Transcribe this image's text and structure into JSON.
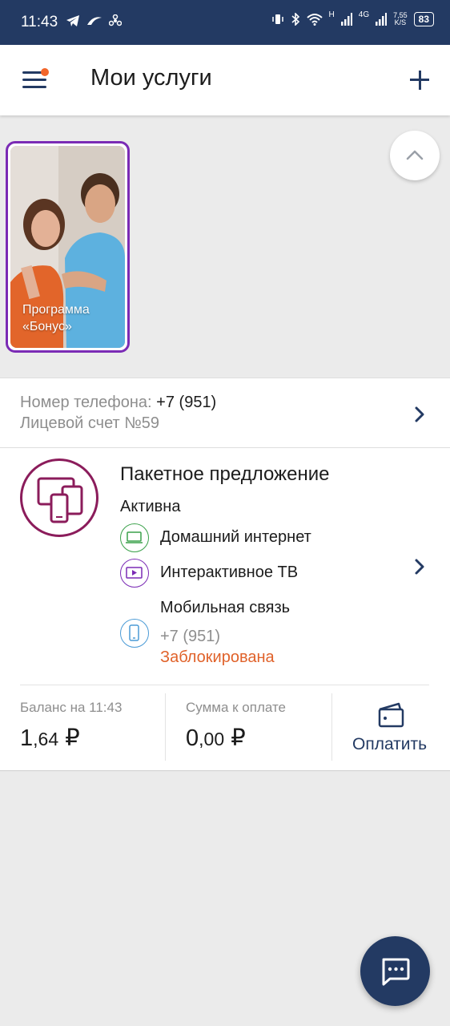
{
  "status_bar": {
    "time": "11:43",
    "network": "4G",
    "network_extra": "H",
    "net_speed_value": "7,55",
    "net_speed_unit": "K/S",
    "battery": "83"
  },
  "app_bar": {
    "title": "Мои услуги"
  },
  "promo": {
    "label_line1": "Программа",
    "label_line2": "«Бонус»"
  },
  "account": {
    "phone_label": "Номер телефона: ",
    "phone_value": "+7 (951)",
    "contract_label": "Лицевой счет №59"
  },
  "package": {
    "title": "Пакетное предложение",
    "status": "Активна",
    "services": [
      {
        "label": "Домашний интернет",
        "icon": "laptop-icon",
        "color": "#3aa14a"
      },
      {
        "label": "Интерактивное ТВ",
        "icon": "tv-play-icon",
        "color": "#7b2bb5"
      },
      {
        "label": "Мобильная связь",
        "icon": "smartphone-icon",
        "color": "#4b9bd6",
        "number": "+7 (951)",
        "state": "Заблокирована"
      }
    ]
  },
  "balance": {
    "label": "Баланс на 11:43",
    "value_int": "1",
    "value_frac": ",64",
    "currency": "₽"
  },
  "due": {
    "label": "Сумма к оплате",
    "value_int": "0",
    "value_frac": ",00",
    "currency": "₽"
  },
  "pay": {
    "label": "Оплатить"
  },
  "colors": {
    "primary": "#233a63",
    "accent_purple": "#7b2bb5",
    "package_icon": "#8b1c5b",
    "warning": "#e0622a",
    "notification_dot": "#f2652a"
  }
}
